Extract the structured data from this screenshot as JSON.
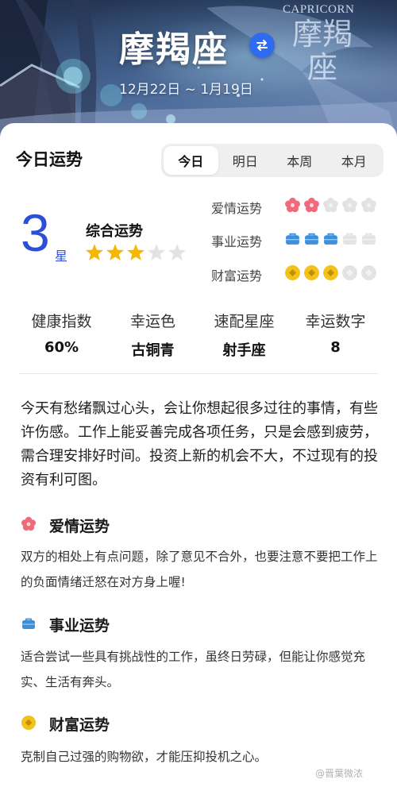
{
  "header": {
    "sign_name": "摩羯座",
    "date_range": "12月22日 ~ 1月19日",
    "english_name": "CAPRICORN",
    "sign_name_artwork": "摩羯座"
  },
  "fortune": {
    "title": "今日运势",
    "tabs": [
      {
        "label": "今日",
        "active": true
      },
      {
        "label": "明日",
        "active": false
      },
      {
        "label": "本周",
        "active": false
      },
      {
        "label": "本月",
        "active": false
      }
    ],
    "overall": {
      "score": "3",
      "unit": "星",
      "label": "综合运势",
      "stars_filled": 3,
      "stars_total": 5
    },
    "aspects": [
      {
        "label": "爱情运势",
        "icon": "flower-icon",
        "filled": 2,
        "total": 5,
        "color": "#f06a7a"
      },
      {
        "label": "事业运势",
        "icon": "briefcase-icon",
        "filled": 3,
        "total": 5,
        "color": "#3d8fdc"
      },
      {
        "label": "财富运势",
        "icon": "coin-icon",
        "filled": 3,
        "total": 5,
        "color": "#f2c21c"
      }
    ],
    "metrics": [
      {
        "label": "健康指数",
        "value": "60%"
      },
      {
        "label": "幸运色",
        "value": "古铜青"
      },
      {
        "label": "速配星座",
        "value": "射手座"
      },
      {
        "label": "幸运数字",
        "value": "8"
      }
    ],
    "summary": "今天有愁绪飘过心头，会让你想起很多过往的事情，有些许伤感。工作上能妥善完成各项任务，只是会感到疲劳，需合理安排好时间。投资上新的机会不大，不过现有的投资有利可图。",
    "sections": [
      {
        "title": "爱情运势",
        "icon": "flower-icon",
        "text": "双方的相处上有点问题，除了意见不合外，也要注意不要把工作上的负面情绪迁怒在对方身上喔!"
      },
      {
        "title": "事业运势",
        "icon": "briefcase-icon",
        "text": "适合尝试一些具有挑战性的工作，虽终日劳碌，但能让你感觉充实、生活有奔头。"
      },
      {
        "title": "财富运势",
        "icon": "coin-icon",
        "text": "克制自己过强的购物欲，才能压抑投机之心。"
      }
    ]
  },
  "watermark": "@晋葉微浓",
  "colors": {
    "accent": "#2c4fd8",
    "star": "#f5b800",
    "switch": "#2f6bf0"
  }
}
